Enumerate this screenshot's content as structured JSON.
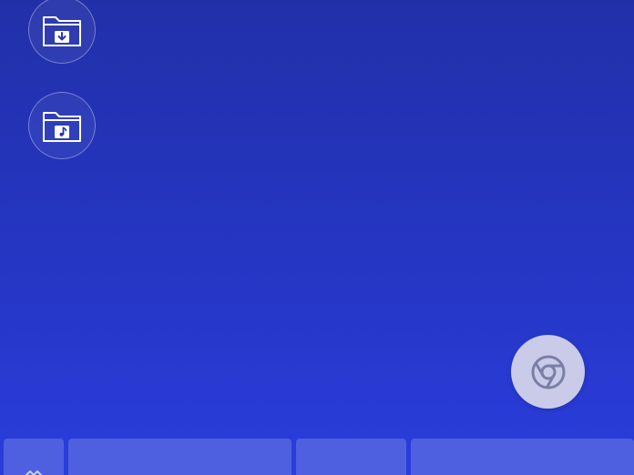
{
  "desktop": {
    "shortcuts": [
      {
        "name": "downloads-folder",
        "icon": "folder-download-icon"
      },
      {
        "name": "music-folder",
        "icon": "folder-music-icon"
      }
    ],
    "fab": {
      "icon": "chrome-icon",
      "color": "#c9cbe8"
    }
  },
  "colors": {
    "background_top": "#2230a8",
    "background_bottom": "#2a3ddb",
    "taskbar_tile": "#4e60e0"
  },
  "taskbar": {
    "tiles": [
      {
        "name": "taskbar-tile-1",
        "icon": "chevron-icon"
      },
      {
        "name": "taskbar-tile-2"
      },
      {
        "name": "taskbar-tile-3"
      },
      {
        "name": "taskbar-tile-4"
      }
    ]
  }
}
